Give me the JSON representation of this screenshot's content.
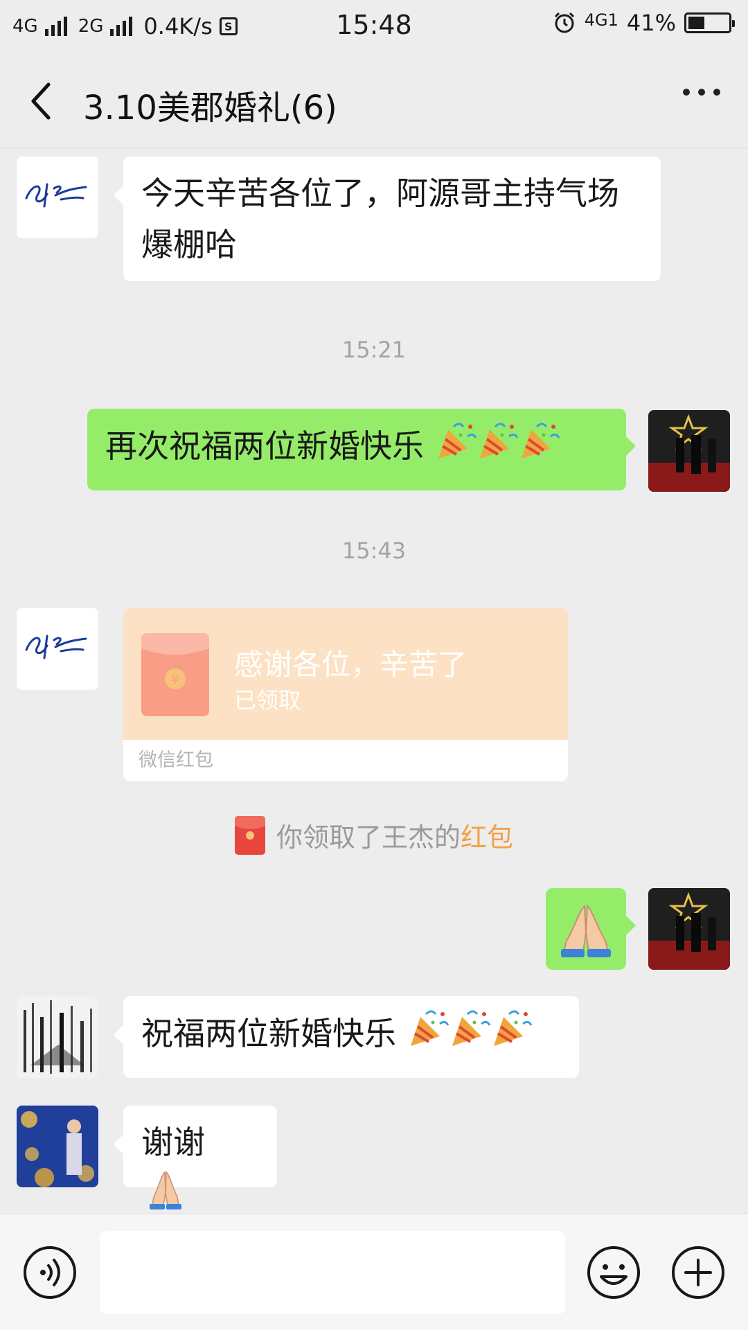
{
  "status_bar": {
    "network1": "4G",
    "network2": "2G",
    "speed": "0.4K/s",
    "sim_icon_char": "S",
    "time": "15:48",
    "network_right": "4G1",
    "battery": "41%",
    "battery_level": 0.41
  },
  "header": {
    "title": "3.10美郡婚礼(6)"
  },
  "messages": [
    {
      "type": "in",
      "text": "今天辛苦各位了，阿源哥主持气场爆棚哈"
    },
    {
      "type": "timestamp",
      "text": "15:21"
    },
    {
      "type": "out",
      "text": "再次祝福两位新婚快乐",
      "emoji": "party-popper x3"
    },
    {
      "type": "timestamp",
      "text": "15:43"
    },
    {
      "type": "red_packet",
      "title": "感谢各位，辛苦了",
      "status": "已领取",
      "footer": "微信红包"
    },
    {
      "type": "system",
      "prefix": "你领取了王杰的",
      "highlight": "红包"
    },
    {
      "type": "out",
      "emoji": "folded-hands"
    },
    {
      "type": "in",
      "text": "祝福两位新婚快乐",
      "emoji": "party-popper x3"
    },
    {
      "type": "in",
      "text": "谢谢",
      "emoji": "folded-hands"
    }
  ],
  "colors": {
    "background": "#ededed",
    "bubble_out": "#95ec69",
    "bubble_in": "#ffffff",
    "packet": "#fde1c4",
    "packet_env": "#fa9d86",
    "highlight": "#f3a046"
  },
  "input_bar": {
    "voice_icon": "voice-icon",
    "emoji_icon": "emoji-icon",
    "plus_icon": "plus-icon",
    "placeholder": ""
  }
}
